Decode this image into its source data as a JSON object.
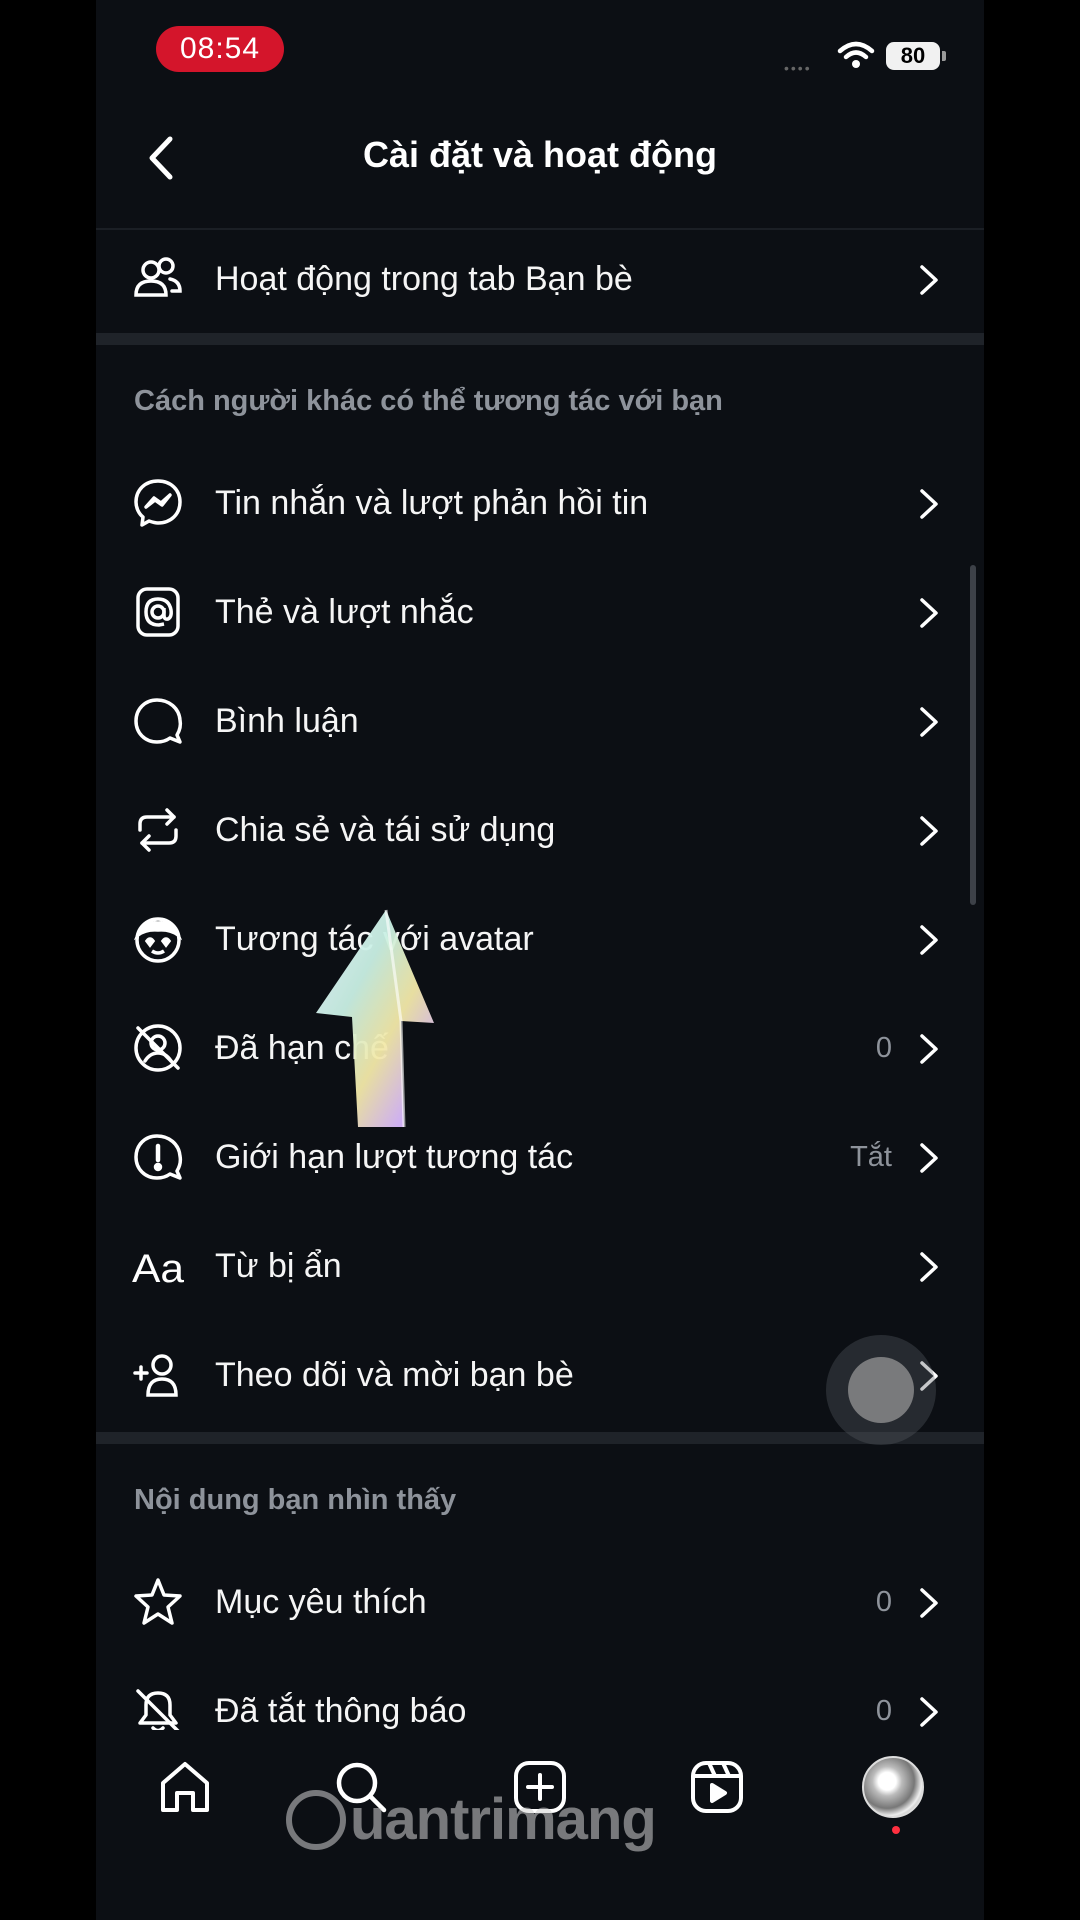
{
  "status_bar": {
    "time": "08:54",
    "signal": "••••",
    "battery": "80"
  },
  "header": {
    "title": "Cài đặt và hoạt động"
  },
  "sections": {
    "top": {
      "label": "Hoạt động trong tab Bạn bè"
    },
    "interact": {
      "title": "Cách người khác có thể tương tác với bạn",
      "items": [
        {
          "label": "Tin nhắn và lượt phản hồi tin",
          "icon": "messenger-icon"
        },
        {
          "label": "Thẻ và lượt nhắc",
          "icon": "mention-icon"
        },
        {
          "label": "Bình luận",
          "icon": "comment-icon"
        },
        {
          "label": "Chia sẻ và tái sử dụng",
          "icon": "repost-icon"
        },
        {
          "label": "Tương tác với avatar",
          "icon": "avatar-face-icon"
        },
        {
          "label": "Đã hạn chế",
          "icon": "restricted-icon",
          "value": "0"
        },
        {
          "label": "Giới hạn lượt tương tác",
          "icon": "limit-interactions-icon",
          "value": "Tắt"
        },
        {
          "label": "Từ bị ẩn",
          "icon": "hidden-words-icon"
        },
        {
          "label": "Theo dõi và mời bạn bè",
          "icon": "add-friend-icon"
        }
      ]
    },
    "content": {
      "title": "Nội dung bạn nhìn thấy",
      "items": [
        {
          "label": "Mục yêu thích",
          "icon": "star-icon",
          "value": "0"
        },
        {
          "label": "Đã tắt thông báo",
          "icon": "bell-off-icon",
          "value": "0"
        }
      ]
    }
  },
  "tab_bar": {
    "items": [
      "home-icon",
      "search-icon",
      "create-icon",
      "reels-icon",
      "profile-avatar"
    ]
  },
  "watermark": "uantrimang",
  "colors": {
    "background": "#0c0f14",
    "text": "#f5f5f5",
    "muted": "#8e939b",
    "time_pill": "#d4152b"
  }
}
